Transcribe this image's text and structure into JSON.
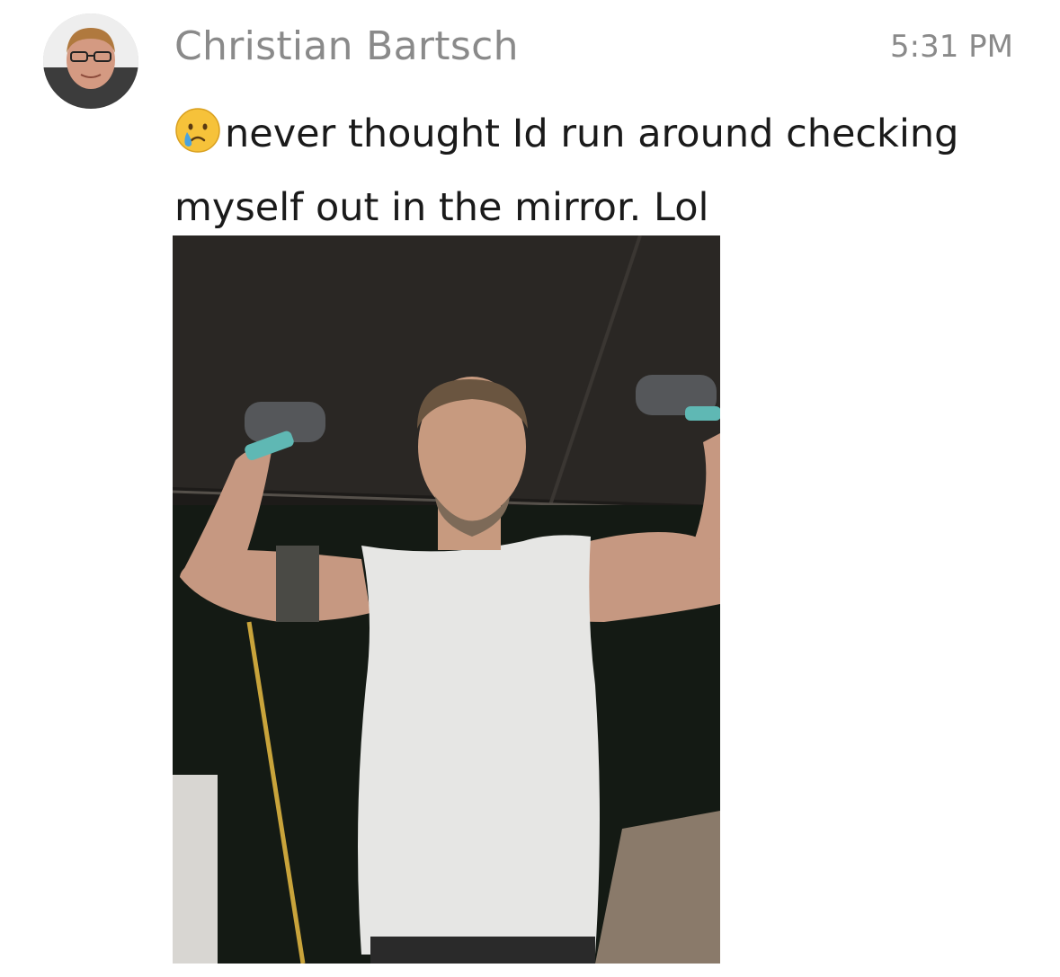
{
  "message": {
    "sender_name": "Christian Bartsch",
    "timestamp": "5:31 PM",
    "emoji_icon": "crying-face-icon",
    "text": "never thought Id run around checking myself out in the mirror. Lol"
  },
  "avatar": {
    "icon": "user-avatar"
  },
  "photo": {
    "subject": "man flexing biceps in white sleeveless shirt",
    "colors": {
      "background": "#1d1b19",
      "shirt": "#e6e6e4",
      "skin": "#c79a7f",
      "accent_band": "#5fb8b4"
    }
  }
}
